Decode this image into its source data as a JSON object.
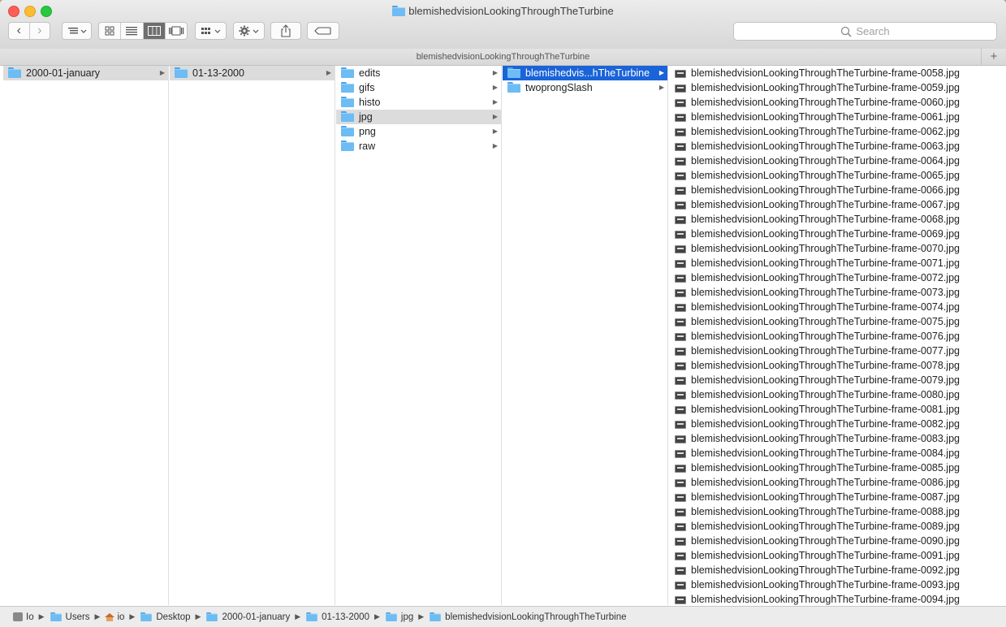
{
  "window": {
    "title": "blemishedvisionLookingThroughTheTurbine",
    "pathbar_title": "blemishedvisionLookingThroughTheTurbine",
    "plus_label": "+"
  },
  "toolbar": {
    "back_label": "‹",
    "forward_label": "›",
    "search_placeholder": "Search"
  },
  "columns": {
    "col1": [
      {
        "label": "2000-01-january",
        "selected": "gray"
      }
    ],
    "col2": [
      {
        "label": "01-13-2000",
        "selected": "gray"
      }
    ],
    "col3": [
      {
        "label": "edits"
      },
      {
        "label": "gifs"
      },
      {
        "label": "histo"
      },
      {
        "label": "jpg",
        "selected": "gray"
      },
      {
        "label": "png"
      },
      {
        "label": "raw"
      }
    ],
    "col4": [
      {
        "label": "blemishedvis...hTheTurbine",
        "selected": "blue"
      },
      {
        "label": "twoprongSlash"
      }
    ],
    "files": [
      "blemishedvisionLookingThroughTheTurbine-frame-0058.jpg",
      "blemishedvisionLookingThroughTheTurbine-frame-0059.jpg",
      "blemishedvisionLookingThroughTheTurbine-frame-0060.jpg",
      "blemishedvisionLookingThroughTheTurbine-frame-0061.jpg",
      "blemishedvisionLookingThroughTheTurbine-frame-0062.jpg",
      "blemishedvisionLookingThroughTheTurbine-frame-0063.jpg",
      "blemishedvisionLookingThroughTheTurbine-frame-0064.jpg",
      "blemishedvisionLookingThroughTheTurbine-frame-0065.jpg",
      "blemishedvisionLookingThroughTheTurbine-frame-0066.jpg",
      "blemishedvisionLookingThroughTheTurbine-frame-0067.jpg",
      "blemishedvisionLookingThroughTheTurbine-frame-0068.jpg",
      "blemishedvisionLookingThroughTheTurbine-frame-0069.jpg",
      "blemishedvisionLookingThroughTheTurbine-frame-0070.jpg",
      "blemishedvisionLookingThroughTheTurbine-frame-0071.jpg",
      "blemishedvisionLookingThroughTheTurbine-frame-0072.jpg",
      "blemishedvisionLookingThroughTheTurbine-frame-0073.jpg",
      "blemishedvisionLookingThroughTheTurbine-frame-0074.jpg",
      "blemishedvisionLookingThroughTheTurbine-frame-0075.jpg",
      "blemishedvisionLookingThroughTheTurbine-frame-0076.jpg",
      "blemishedvisionLookingThroughTheTurbine-frame-0077.jpg",
      "blemishedvisionLookingThroughTheTurbine-frame-0078.jpg",
      "blemishedvisionLookingThroughTheTurbine-frame-0079.jpg",
      "blemishedvisionLookingThroughTheTurbine-frame-0080.jpg",
      "blemishedvisionLookingThroughTheTurbine-frame-0081.jpg",
      "blemishedvisionLookingThroughTheTurbine-frame-0082.jpg",
      "blemishedvisionLookingThroughTheTurbine-frame-0083.jpg",
      "blemishedvisionLookingThroughTheTurbine-frame-0084.jpg",
      "blemishedvisionLookingThroughTheTurbine-frame-0085.jpg",
      "blemishedvisionLookingThroughTheTurbine-frame-0086.jpg",
      "blemishedvisionLookingThroughTheTurbine-frame-0087.jpg",
      "blemishedvisionLookingThroughTheTurbine-frame-0088.jpg",
      "blemishedvisionLookingThroughTheTurbine-frame-0089.jpg",
      "blemishedvisionLookingThroughTheTurbine-frame-0090.jpg",
      "blemishedvisionLookingThroughTheTurbine-frame-0091.jpg",
      "blemishedvisionLookingThroughTheTurbine-frame-0092.jpg",
      "blemishedvisionLookingThroughTheTurbine-frame-0093.jpg",
      "blemishedvisionLookingThroughTheTurbine-frame-0094.jpg"
    ]
  },
  "statusbar": {
    "path": [
      {
        "label": "Io",
        "icon": "hard-drive-icon"
      },
      {
        "label": "Users",
        "icon": "folder-icon"
      },
      {
        "label": "io",
        "icon": "home-icon"
      },
      {
        "label": "Desktop",
        "icon": "folder-icon"
      },
      {
        "label": "2000-01-january",
        "icon": "folder-icon"
      },
      {
        "label": "01-13-2000",
        "icon": "folder-icon"
      },
      {
        "label": "jpg",
        "icon": "folder-icon"
      },
      {
        "label": "blemishedvisionLookingThroughTheTurbine",
        "icon": "folder-icon"
      }
    ]
  },
  "colors": {
    "selection_blue": "#1a63d8",
    "selection_gray": "#dcdcdc",
    "folder_blue": "#6dbcf3"
  }
}
